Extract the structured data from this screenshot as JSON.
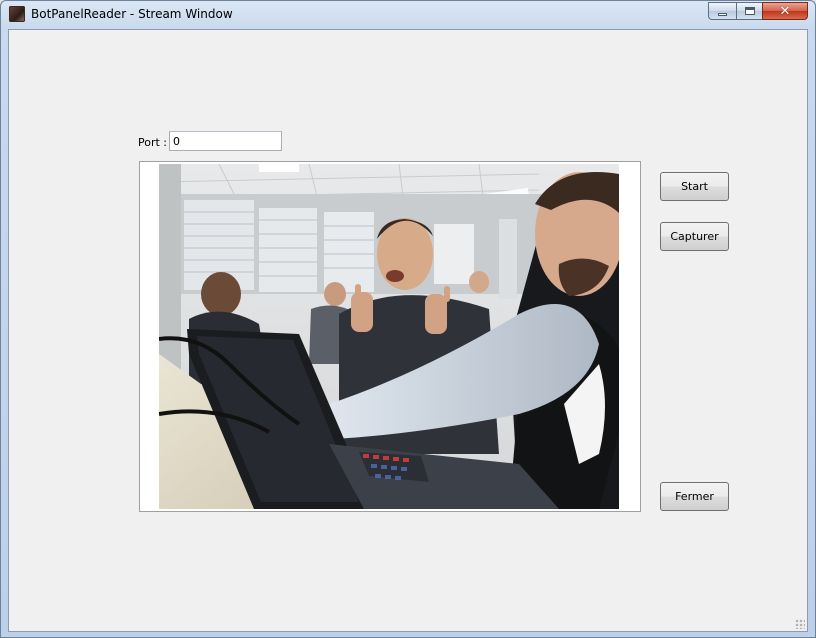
{
  "window": {
    "title": "BotPanelReader - Stream Window",
    "icon": "app-icon",
    "controls": [
      "minimize-icon",
      "maximize-icon",
      "close-icon"
    ]
  },
  "port": {
    "label": "Port :",
    "value": "0"
  },
  "buttons": {
    "start": "Start",
    "capture": "Capturer",
    "close": "Fermer"
  },
  "stream": {
    "content": "webcam-stream-image"
  },
  "colors": {
    "titlebar": "#c9d9ee",
    "client_bg": "#f0f0f0",
    "close_button": "#c0361c"
  }
}
